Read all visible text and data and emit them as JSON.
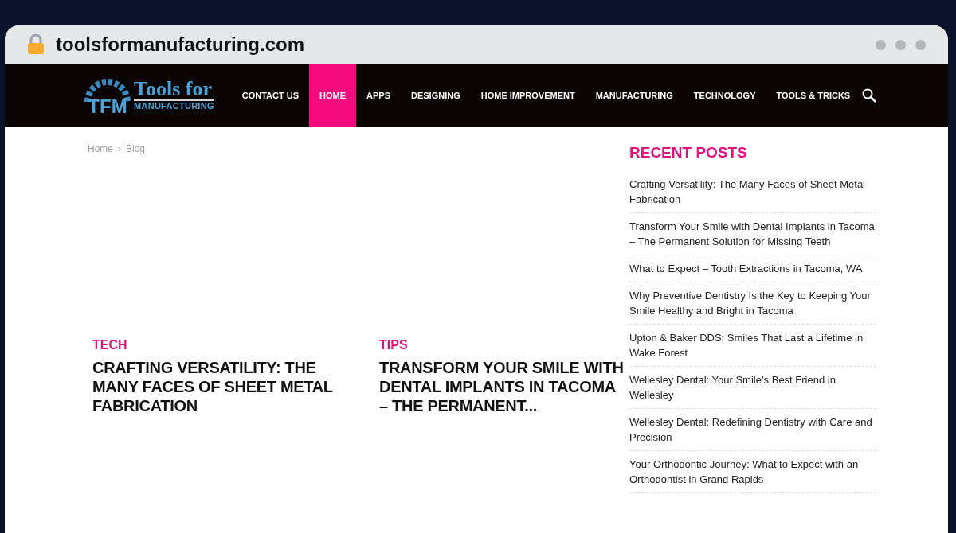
{
  "browser": {
    "url": "toolsformanufacturing.com"
  },
  "logo": {
    "monogram": "TFM",
    "title": "Tools for",
    "subtitle": "MANUFACTURING"
  },
  "nav": [
    {
      "label": "CONTACT US",
      "selected": false
    },
    {
      "label": "HOME",
      "selected": true
    },
    {
      "label": "APPS",
      "selected": false
    },
    {
      "label": "DESIGNING",
      "selected": false
    },
    {
      "label": "HOME IMPROVEMENT",
      "selected": false
    },
    {
      "label": "MANUFACTURING",
      "selected": false
    },
    {
      "label": "TECHNOLOGY",
      "selected": false
    },
    {
      "label": "TOOLS & TRICKS",
      "selected": false
    }
  ],
  "breadcrumb": {
    "items": [
      "Home",
      "Blog"
    ],
    "separator": "›"
  },
  "posts": [
    {
      "category": "TECH",
      "title": "CRAFTING VERSATILITY: THE MANY FACES OF SHEET METAL FABRICATION"
    },
    {
      "category": "TIPS",
      "title": "TRANSFORM YOUR SMILE WITH DENTAL IMPLANTS IN TACOMA – THE PERMANENT..."
    }
  ],
  "recent_posts": {
    "heading": "RECENT POSTS",
    "items": [
      "Crafting Versatility: The Many Faces of Sheet Metal Fabrication",
      "Transform Your Smile with Dental Implants in Tacoma – The Permanent Solution for Missing Teeth",
      "What to Expect – Tooth Extractions in Tacoma, WA",
      "Why Preventive Dentistry Is the Key to Keeping Your Smile Healthy and Bright in Tacoma",
      "Upton & Baker DDS: Smiles That Last a Lifetime in Wake Forest",
      "Wellesley Dental: Your Smile’s Best Friend in Wellesley",
      "Wellesley Dental: Redefining Dentistry with Care and Precision",
      "Your Orthodontic Journey: What to Expect with an Orthodontist in Grand Rapids"
    ]
  }
}
